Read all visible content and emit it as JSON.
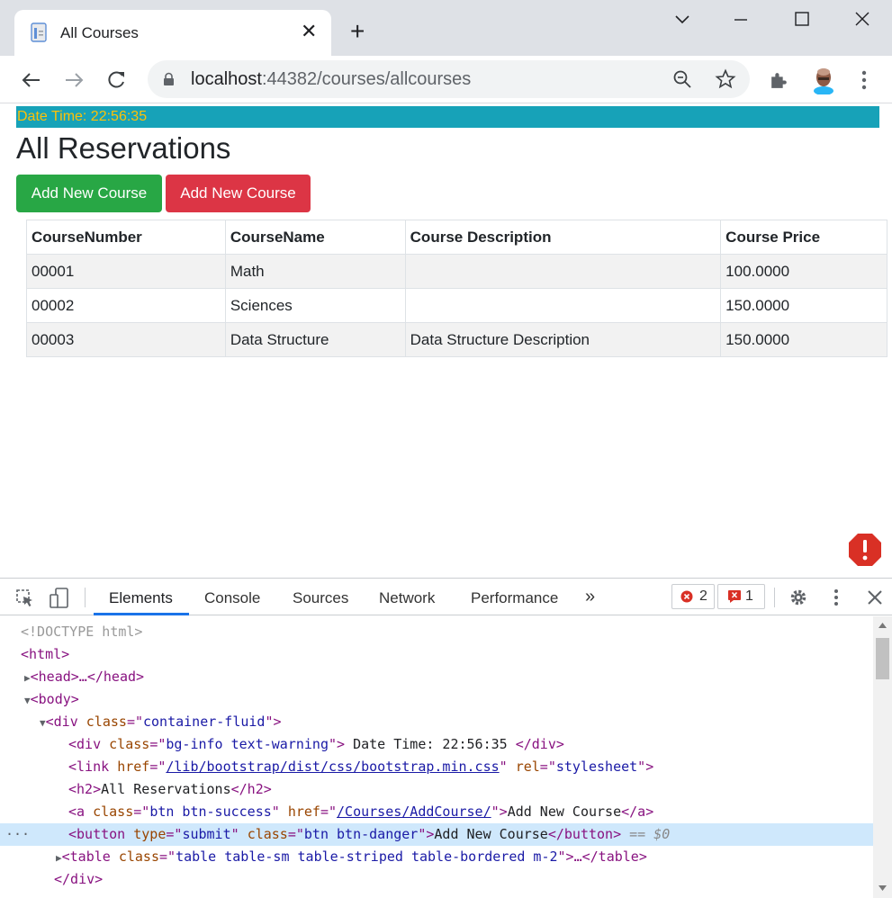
{
  "browser": {
    "tab_title": "All Courses",
    "tab_close": "✕",
    "new_tab": "+",
    "url_host": "localhost",
    "url_rest": ":44382/courses/allcourses"
  },
  "page": {
    "date_time": "Date Time: 22:56:35",
    "heading": "All Reservations",
    "btn_success": "Add New Course",
    "btn_danger": "Add New Course",
    "table": {
      "headers": [
        "CourseNumber",
        "CourseName",
        "Course Description",
        "Course Price"
      ],
      "rows": [
        [
          "00001",
          "Math",
          "",
          "100.0000"
        ],
        [
          "00002",
          "Sciences",
          "",
          "150.0000"
        ],
        [
          "00003",
          "Data Structure",
          "Data Structure Description",
          "150.0000"
        ]
      ]
    }
  },
  "devtools": {
    "tabs": [
      "Elements",
      "Console",
      "Sources",
      "Network",
      "Performance"
    ],
    "more": "»",
    "error_count": "2",
    "issue_count": "1",
    "dom": {
      "doctype": "<!DOCTYPE html>",
      "html_open": "<html>",
      "head_line": "<head>…</head>",
      "body_open": "<body>",
      "div_container": "container-fluid",
      "div_info_class": "bg-info text-warning",
      "div_info_text": " Date Time: 22:56:35 ",
      "link_href": "/lib/bootstrap/dist/css/bootstrap.min.css",
      "link_rel": "stylesheet",
      "h2_text": "All Reservations",
      "a_class": "btn btn-success",
      "a_href": "/Courses/AddCourse/",
      "a_text": "Add New Course",
      "button_type": "submit",
      "button_class": "btn btn-danger",
      "button_text": "Add New Course",
      "eq0": " == $0",
      "table_class": "table table-sm table-striped table-bordered m-2",
      "div_close": "</div>",
      "dots": "···"
    }
  },
  "colors": {
    "info": "#17a2b8",
    "warning": "#ffc107",
    "success": "#28a745",
    "danger": "#dc3545"
  }
}
